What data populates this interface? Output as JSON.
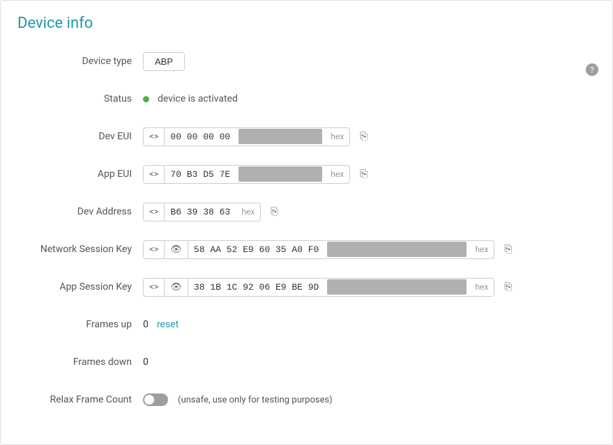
{
  "title": "Device info",
  "helpIcon": "?",
  "fields": {
    "deviceType": {
      "label": "Device type",
      "value": "ABP"
    },
    "status": {
      "label": "Status",
      "text": "device is activated"
    },
    "devEUI": {
      "label": "Dev EUI",
      "visible": "00 00 00 00",
      "hexLabel": "hex"
    },
    "appEUI": {
      "label": "App EUI",
      "visible": "70 B3 D5 7E",
      "hexLabel": "hex"
    },
    "devAddress": {
      "label": "Dev Address",
      "visible": "B6 39 38 63",
      "hexLabel": "hex"
    },
    "networkSessionKey": {
      "label": "Network Session Key",
      "visible": "58 AA 52 E9 60 35 A0 F0",
      "hexLabel": "hex"
    },
    "appSessionKey": {
      "label": "App Session Key",
      "visible": "38 1B 1C 92 06 E9 BE 9D",
      "hexLabel": "hex"
    },
    "framesUp": {
      "label": "Frames up",
      "value": "0",
      "resetLabel": "reset"
    },
    "framesDown": {
      "label": "Frames down",
      "value": "0"
    },
    "relaxFrameCount": {
      "label": "Relax Frame Count",
      "note": "(unsafe, use only for testing purposes)"
    }
  }
}
